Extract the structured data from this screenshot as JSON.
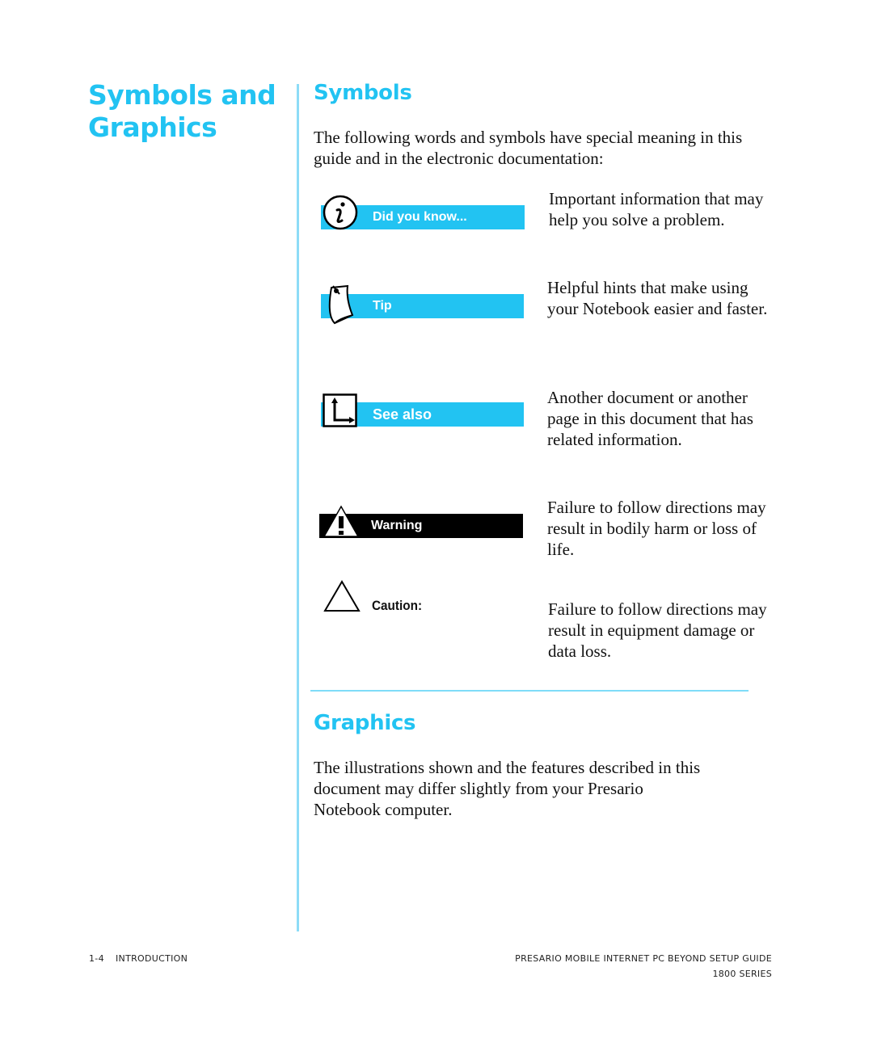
{
  "page": {
    "main_heading": "Symbols and Graphics",
    "symbols_section": {
      "heading": "Symbols",
      "intro": "The following words and symbols have special meaning in this guide and in the electronic documentation:",
      "items": [
        {
          "icon": "info-icon",
          "label": "Did you know...",
          "description": "Important information that may help you solve a problem.",
          "bar_color": "#22c3f2"
        },
        {
          "icon": "tip-note-icon",
          "label": "Tip",
          "description": "Helpful hints that make using your Notebook easier and faster.",
          "bar_color": "#22c3f2"
        },
        {
          "icon": "see-also-arrow-icon",
          "label": "See also",
          "description": "Another document or another page in this document that has related information.",
          "bar_color": "#22c3f2"
        },
        {
          "icon": "warning-icon",
          "label": "Warning",
          "description": "Failure to follow directions may result in bodily harm or loss of life.",
          "bar_color": "#000000"
        },
        {
          "icon": "caution-icon",
          "label": "Caution:",
          "description": "Failure to follow directions may result in equipment damage or data loss."
        }
      ]
    },
    "graphics_section": {
      "heading": "Graphics",
      "body": "The illustrations shown and the features described in this document may differ slightly from your Presario Notebook computer."
    },
    "footer": {
      "page_number": "1-4",
      "chapter": "INTRODUCTION",
      "book_title": "PRESARIO MOBILE INTERNET PC BEYOND SETUP GUIDE",
      "series": "1800 SERIES"
    },
    "accent_color": "#22c3f2"
  }
}
